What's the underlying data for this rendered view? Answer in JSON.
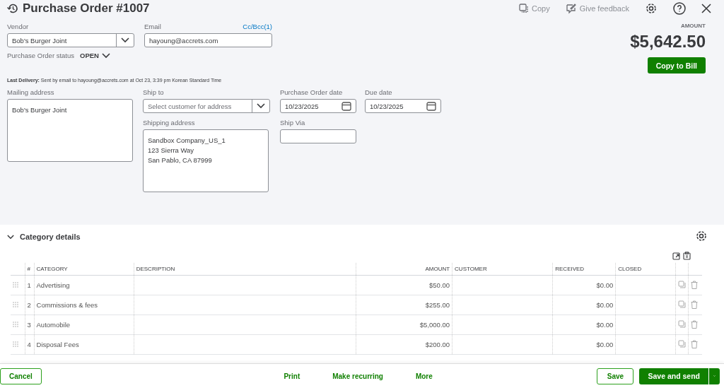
{
  "header": {
    "title": "Purchase Order #1007",
    "actions": [
      {
        "kind": "copy",
        "label": "Copy"
      },
      {
        "kind": "feedback",
        "label": "Give feedback"
      },
      {
        "kind": "settings"
      },
      {
        "kind": "help"
      },
      {
        "kind": "close"
      }
    ]
  },
  "vendor": {
    "label": "Vendor",
    "value": "Bob's Burger Joint"
  },
  "email": {
    "label": "Email",
    "value": "hayoung@accrets.com",
    "cc_link": "Cc/Bcc(1)"
  },
  "status": {
    "label": "Purchase Order status",
    "value": "OPEN"
  },
  "amount": {
    "label": "AMOUNT",
    "value": "$5,642.50",
    "button": "Copy to Bill"
  },
  "last_delivery": "**Last Delivery:** Sent by email to hayoung@accrets.com at Oct 23, 3:39 pm Korean Standard Time",
  "mailing_address": {
    "label": "Mailing address",
    "value": "Bob's Burger Joint"
  },
  "ship_to": {
    "label": "Ship to",
    "placeholder": "Select customer for address"
  },
  "shipping_address": {
    "label": "Shipping address",
    "lines": [
      "Sandbox Company_US_1",
      "123 Sierra Way",
      "San Pablo, CA  87999"
    ]
  },
  "po_date": {
    "label": "Purchase Order date",
    "value": "10/23/2025"
  },
  "due_date": {
    "label": "Due date",
    "value": "10/23/2025"
  },
  "ship_via": {
    "label": "Ship Via"
  },
  "category_details": {
    "title": "Category details",
    "expanded": true,
    "columns": [
      "#",
      "CATEGORY",
      "DESCRIPTION",
      "AMOUNT",
      "CUSTOMER",
      "RECEIVED",
      "CLOSED"
    ],
    "rows": [
      {
        "num": "1",
        "category": "Advertising",
        "amount": "$50.00",
        "received": "$0.00"
      },
      {
        "num": "2",
        "category": "Commissions & fees",
        "amount": "$255.00",
        "received": "$0.00"
      },
      {
        "num": "3",
        "category": "Automobile",
        "amount": "$5,000.00",
        "received": "$0.00"
      },
      {
        "num": "4",
        "category": "Disposal Fees",
        "amount": "$200.00",
        "received": "$0.00"
      }
    ]
  },
  "footer": {
    "cancel": "Cancel",
    "links": [
      "Print",
      "Make recurring",
      "More"
    ],
    "save": "Save",
    "save_and_send": "Save and send"
  }
}
